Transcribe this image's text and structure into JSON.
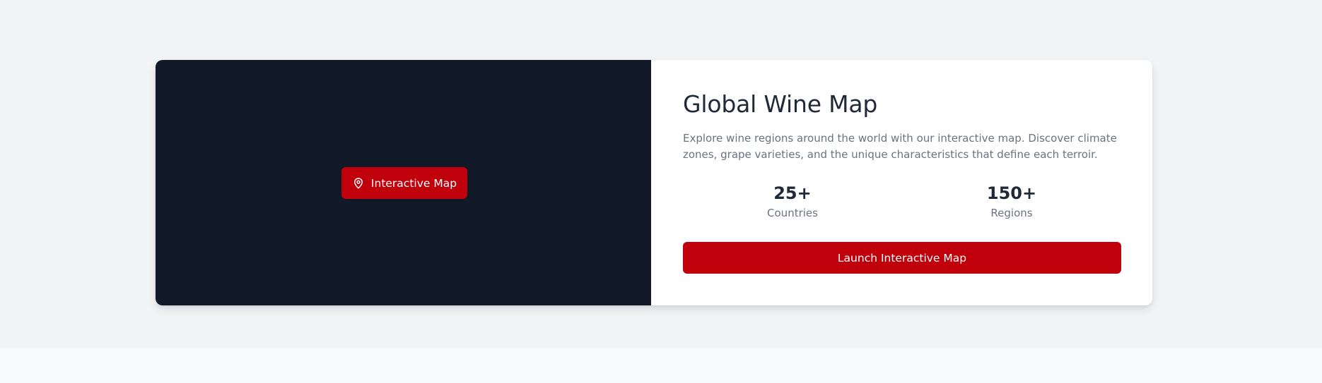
{
  "map_panel": {
    "badge_label": "Interactive Map",
    "badge_icon": "map-pin-icon"
  },
  "info": {
    "title": "Global Wine Map",
    "description": "Explore wine regions around the world with our interactive map. Discover climate zones, grape varieties, and the unique characteristics that define each terroir.",
    "stats": [
      {
        "value": "25+",
        "label": "Countries"
      },
      {
        "value": "150+",
        "label": "Regions"
      }
    ],
    "launch_label": "Launch Interactive Map"
  },
  "colors": {
    "accent": "#c0000a",
    "map_background": "#111827",
    "heading": "#1f2937",
    "muted_text": "#6b7280",
    "page_background": "#f3f4f6"
  }
}
